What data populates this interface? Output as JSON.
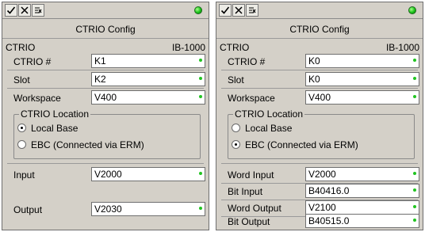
{
  "colors": {
    "panel_bg": "#d4d0c8",
    "status_led": "#19c21a",
    "field_dot": "#21c421"
  },
  "panels": [
    {
      "toolbar": {
        "buttons": [
          "check-icon",
          "cancel-icon",
          "help-icon"
        ],
        "status_led": "green"
      },
      "title": "CTRIO Config",
      "header": {
        "left": "CTRIO",
        "right": "IB-1000"
      },
      "fields": {
        "ctrio_num": {
          "label": "CTRIO #",
          "value": "K1"
        },
        "slot": {
          "label": "Slot",
          "value": "K2"
        },
        "workspace": {
          "label": "Workspace",
          "value": "V400"
        }
      },
      "location": {
        "legend": "CTRIO Location",
        "option_local": "Local Base",
        "option_ebc": "EBC (Connected via ERM)",
        "selected": "Local Base"
      },
      "io": {
        "input": {
          "label": "Input",
          "value": "V2000"
        },
        "output": {
          "label": "Output",
          "value": "V2030"
        }
      }
    },
    {
      "toolbar": {
        "buttons": [
          "check-icon",
          "cancel-icon",
          "help-icon"
        ],
        "status_led": "green"
      },
      "title": "CTRIO Config",
      "header": {
        "left": "CTRIO",
        "right": "IB-1000"
      },
      "fields": {
        "ctrio_num": {
          "label": "CTRIO #",
          "value": "K0"
        },
        "slot": {
          "label": "Slot",
          "value": "K0"
        },
        "workspace": {
          "label": "Workspace",
          "value": "V400"
        }
      },
      "location": {
        "legend": "CTRIO Location",
        "option_local": "Local Base",
        "option_ebc": "EBC (Connected via ERM)",
        "selected": "EBC (Connected via ERM)"
      },
      "io": {
        "word_input": {
          "label": "Word Input",
          "value": "V2000"
        },
        "bit_input": {
          "label": "Bit Input",
          "value": "B40416.0"
        },
        "word_output": {
          "label": "Word Output",
          "value": "V2100"
        },
        "bit_output": {
          "label": "Bit Output",
          "value": "B40515.0"
        }
      }
    }
  ]
}
